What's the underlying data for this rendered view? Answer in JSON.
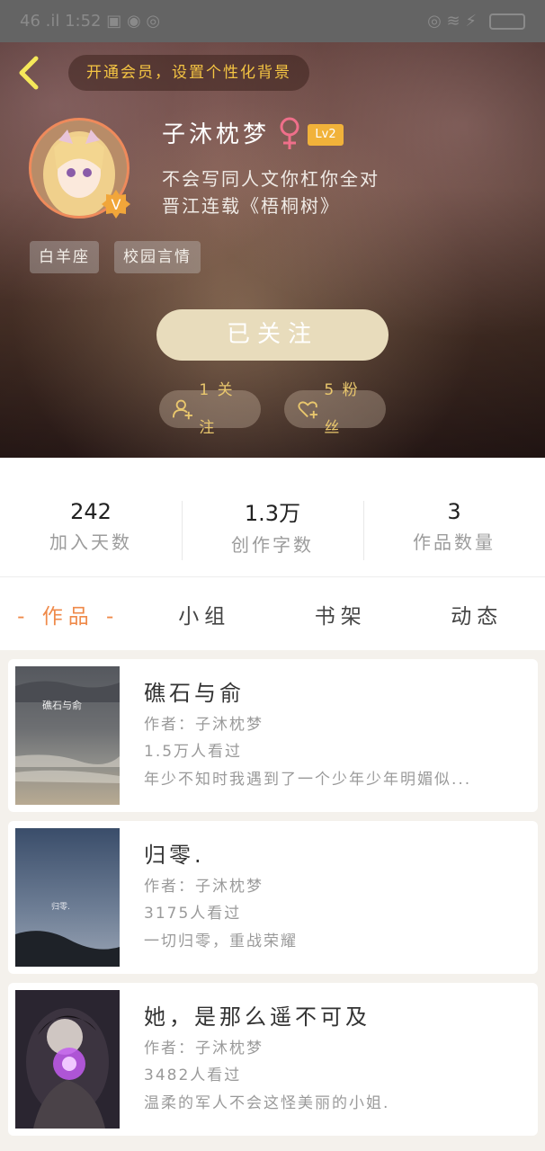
{
  "status_bar": {
    "left": "46 .il 1:52 ▣ ◉ ◎",
    "right": "◎ ≋ ⚡"
  },
  "header": {
    "vip_label": "开通会员，设置个性化背景",
    "username": "子沐枕梦",
    "level": "Lv2",
    "bio_line1": "不会写同人文你杠你全对",
    "bio_line2": "晋江连载《梧桐树》",
    "tags": [
      "白羊座",
      "校园言情"
    ],
    "follow_button": "已关注",
    "following_label": "1 关注",
    "fans_label": "5 粉丝",
    "badge_letter": "V"
  },
  "stats": [
    {
      "value": "242",
      "label": "加入天数"
    },
    {
      "value": "1.3万",
      "label": "创作字数"
    },
    {
      "value": "3",
      "label": "作品数量"
    }
  ],
  "tabs": [
    {
      "label": "- 作品 -",
      "active": true
    },
    {
      "label": "小组",
      "active": false
    },
    {
      "label": "书架",
      "active": false
    },
    {
      "label": "动态",
      "active": false
    }
  ],
  "works": [
    {
      "title": "礁石与俞",
      "author": "作者：子沐枕梦",
      "views": "1.5万人看过",
      "desc": "年少不知时我遇到了一个少年少年明媚似...",
      "cover_text": "礁石与俞"
    },
    {
      "title": "归零.",
      "author": "作者：子沐枕梦",
      "views": "3175人看过",
      "desc": "一切归零，重战荣耀",
      "cover_text": "归零."
    },
    {
      "title": "她，是那么遥不可及",
      "author": "作者：子沐枕梦",
      "views": "3482人看过",
      "desc": "温柔的军人不会这怪美丽的小姐."
    }
  ],
  "colors": {
    "accent": "#ef8a4a",
    "vip_text": "#f5c543",
    "level_badge": "#f1b23a",
    "follow_button": "#e8dcbc"
  }
}
